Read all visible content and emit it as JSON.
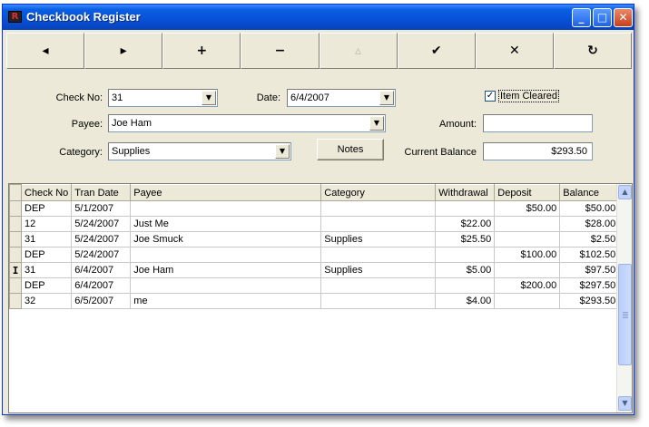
{
  "window": {
    "title": "Checkbook Register"
  },
  "toolbar": {
    "buttons": [
      {
        "name": "prev-record-button",
        "glyph": "◂",
        "enabled": true
      },
      {
        "name": "next-record-button",
        "glyph": "▸",
        "enabled": true
      },
      {
        "name": "add-record-button",
        "glyph": "+",
        "enabled": true
      },
      {
        "name": "delete-record-button",
        "glyph": "−",
        "enabled": true
      },
      {
        "name": "edit-record-button",
        "glyph": "▵",
        "enabled": false
      },
      {
        "name": "post-record-button",
        "glyph": "✔",
        "enabled": true
      },
      {
        "name": "cancel-record-button",
        "glyph": "✕",
        "enabled": true
      },
      {
        "name": "refresh-button",
        "glyph": "↻",
        "enabled": true
      }
    ]
  },
  "form": {
    "check_no_label": "Check No:",
    "check_no_value": "31",
    "date_label": "Date:",
    "date_value": "6/4/2007",
    "item_cleared_label": "Item Cleared",
    "item_cleared_checked": true,
    "payee_label": "Payee:",
    "payee_value": "Joe Ham",
    "amount_label": "Amount:",
    "amount_value": "",
    "category_label": "Category:",
    "category_value": "Supplies",
    "notes_label": "Notes",
    "balance_label": "Current Balance",
    "balance_value": "$293.50"
  },
  "grid": {
    "columns": [
      "Check No",
      "Tran Date",
      "Payee",
      "Category",
      "Withdrawal",
      "Deposit",
      "Balance"
    ],
    "rows": [
      [
        "DEP",
        "5/1/2007",
        "",
        "",
        "",
        "$50.00",
        "$50.00"
      ],
      [
        "12",
        "5/24/2007",
        "Just Me",
        "",
        "$22.00",
        "",
        "$28.00"
      ],
      [
        "31",
        "5/24/2007",
        "Joe Smuck",
        "Supplies",
        "$25.50",
        "",
        "$2.50"
      ],
      [
        "DEP",
        "5/24/2007",
        "",
        "",
        "",
        "$100.00",
        "$102.50"
      ],
      [
        "31",
        "6/4/2007",
        "Joe Ham",
        "Supplies",
        "$5.00",
        "",
        "$97.50"
      ],
      [
        "DEP",
        "6/4/2007",
        "",
        "",
        "",
        "$200.00",
        "$297.50"
      ],
      [
        "32",
        "6/5/2007",
        "me",
        "",
        "$4.00",
        "",
        "$293.50"
      ]
    ],
    "current_row": 4,
    "current_row_marker": "I"
  },
  "colors": {
    "titlebar": "#0650d8",
    "window_face": "#ece9d8"
  }
}
